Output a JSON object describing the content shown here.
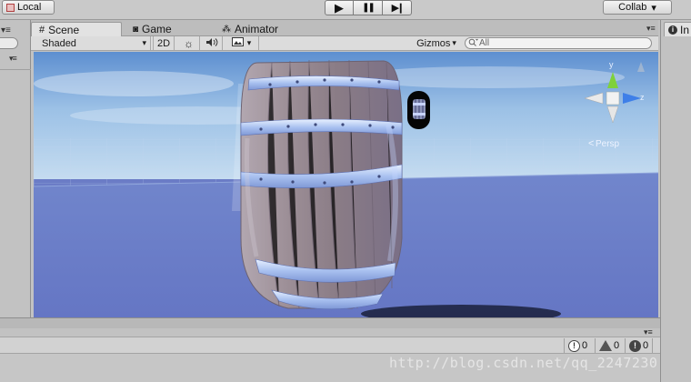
{
  "toolbar": {
    "local_label": "Local",
    "play_icon": "▶",
    "pause_icon": "❚❚",
    "step_icon": "▶❙",
    "collab_label": "Collab",
    "collab_arrow": "▾"
  },
  "tabs": {
    "scene": "Scene",
    "game": "Game",
    "animator": "Animator",
    "menu_glyph": "▾≡"
  },
  "scene_toolbar": {
    "shading_mode": "Shaded",
    "dropdown_arrow": "▾",
    "mode_2d": "2D",
    "gizmos": "Gizmos",
    "search_placeholder": "All"
  },
  "viewport": {
    "axis_y": "y",
    "axis_z": "z",
    "projection_label": "Persp",
    "sky_color": "#8fb6e2",
    "floor_color": "#6c7ec8"
  },
  "inspector": {
    "tab_label_partial": "In"
  },
  "left_panel": {
    "menu_glyph": "▾≡"
  },
  "console": {
    "info_count": "0",
    "warning_count": "0",
    "error_count": "0",
    "menu_glyph": "▾≡"
  },
  "watermark": "http://blog.csdn.net/qq_2247230"
}
